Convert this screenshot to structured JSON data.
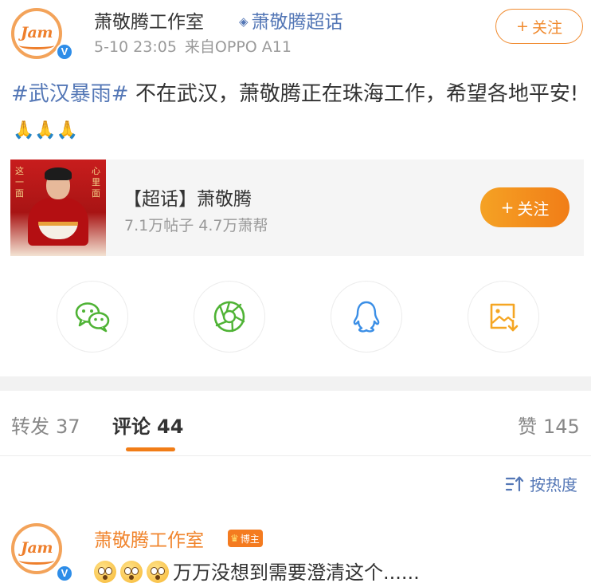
{
  "post": {
    "author": {
      "name": "萧敬腾工作室",
      "avatar_logo": "Jam",
      "verified_badge": "V"
    },
    "topic_link": "萧敬腾超话",
    "topic_icon": "diamond-icon",
    "timestamp": "5-10 23:05",
    "source": "来自OPPO A11",
    "follow_label": "关注",
    "follow_plus": "+",
    "hashtag": "#武汉暴雨#",
    "body_text": " 不在武汉，萧敬腾正在珠海工作，希望各地平安!",
    "pray_emoji": "🙏🙏🙏"
  },
  "super_topic_card": {
    "title": "【超话】萧敬腾",
    "stats": "7.1万帖子 4.7万萧帮",
    "follow_label": "关注",
    "follow_plus": "+",
    "thumb_text_left": "这一面",
    "thumb_text_right": "心里面"
  },
  "share": {
    "items": [
      {
        "name": "wechat",
        "icon": "wechat-icon"
      },
      {
        "name": "moments",
        "icon": "moments-icon"
      },
      {
        "name": "qq",
        "icon": "qq-icon"
      },
      {
        "name": "save-image",
        "icon": "save-image-icon"
      }
    ]
  },
  "tabs": {
    "repost": {
      "label": "转发",
      "count": "37"
    },
    "comments": {
      "label": "评论",
      "count": "44"
    },
    "likes": {
      "label": "赞",
      "count": "145"
    }
  },
  "sort": {
    "label": "按热度",
    "icon": "sort-icon"
  },
  "comment": {
    "author": "萧敬腾工作室",
    "badge": "博主",
    "text": "万万没想到需要澄清这个......"
  },
  "colors": {
    "accent_orange": "#f17d17",
    "link_blue": "#5477b6",
    "wechat_green": "#4fb335"
  }
}
